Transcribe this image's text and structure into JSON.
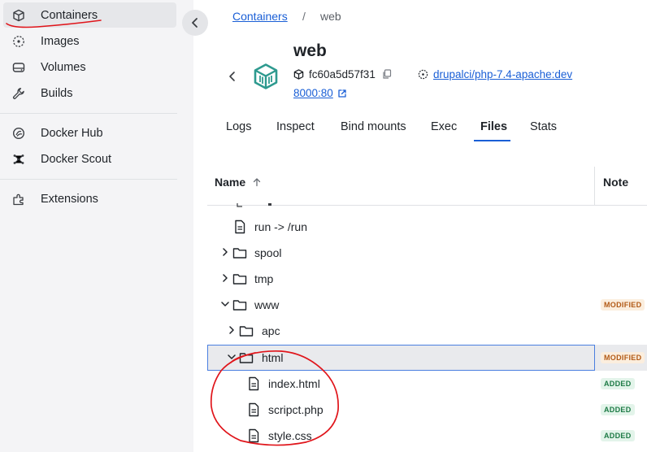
{
  "sidebar": {
    "items": [
      {
        "label": "Containers",
        "icon": "cube-icon",
        "active": true
      },
      {
        "label": "Images",
        "icon": "images-icon"
      },
      {
        "label": "Volumes",
        "icon": "volume-icon"
      },
      {
        "label": "Builds",
        "icon": "wrench-icon"
      },
      {
        "label": "Docker Hub",
        "icon": "hub-icon"
      },
      {
        "label": "Docker Scout",
        "icon": "scout-icon"
      },
      {
        "label": "Extensions",
        "icon": "puzzle-icon"
      }
    ]
  },
  "breadcrumb": {
    "parent": "Containers",
    "separator": "/",
    "current": "web"
  },
  "container": {
    "name": "web",
    "id": "fc60a5d57f31",
    "image": "drupalci/php-7.4-apache:dev",
    "port": "8000:80"
  },
  "tabs": [
    {
      "label": "Logs"
    },
    {
      "label": "Inspect"
    },
    {
      "label": "Bind mounts"
    },
    {
      "label": "Exec"
    },
    {
      "label": "Files",
      "active": true
    },
    {
      "label": "Stats"
    }
  ],
  "table": {
    "columns": {
      "name": "Name",
      "note": "Note"
    },
    "rows": [
      {
        "name": "run -> /run",
        "type": "file",
        "note": ""
      },
      {
        "name": "spool",
        "type": "folder",
        "expanded": false,
        "note": ""
      },
      {
        "name": "tmp",
        "type": "folder",
        "expanded": false,
        "note": ""
      },
      {
        "name": "www",
        "type": "folder",
        "expanded": true,
        "note": "MODIFIED"
      },
      {
        "name": "apc",
        "type": "folder",
        "expanded": false,
        "note": ""
      },
      {
        "name": "html",
        "type": "folder",
        "expanded": true,
        "note": "MODIFIED",
        "selected": true
      },
      {
        "name": "index.html",
        "type": "file",
        "note": "ADDED"
      },
      {
        "name": "scripct.php",
        "type": "file",
        "note": "ADDED"
      },
      {
        "name": "style.css",
        "type": "file",
        "note": "ADDED"
      }
    ]
  },
  "colors": {
    "accent": "#1a5fd6",
    "annotation": "#e0151b",
    "container_icon": "#2e9a8f"
  }
}
